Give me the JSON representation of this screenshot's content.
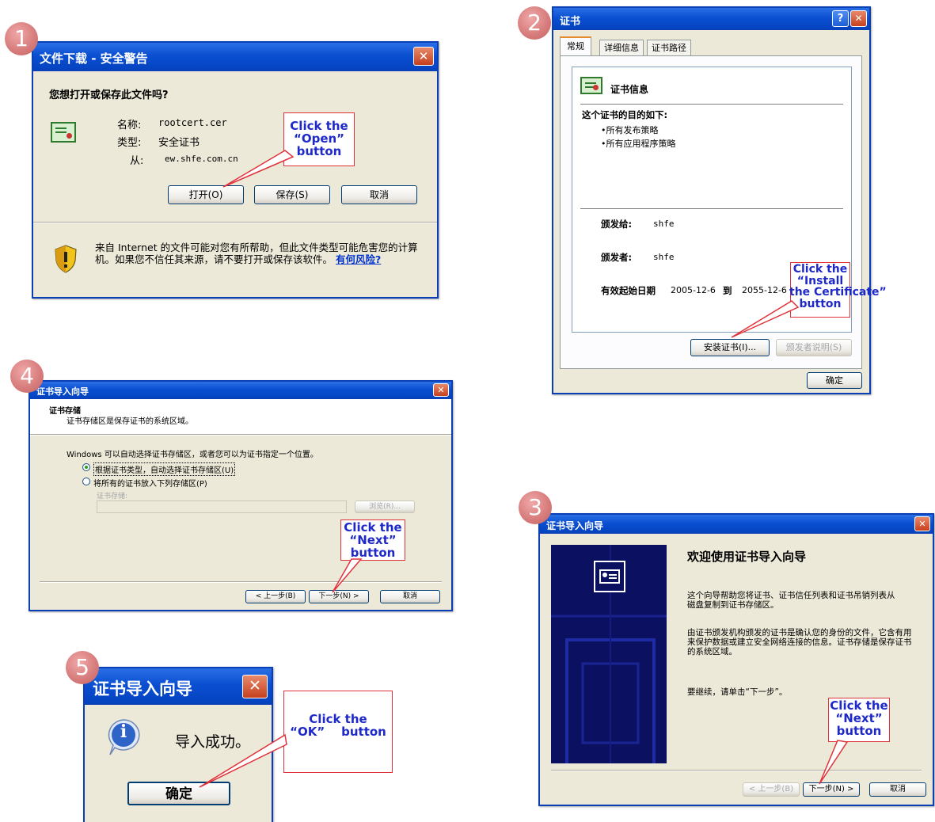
{
  "step1": {
    "badge": "1",
    "title": "文件下载 - 安全警告",
    "close": "✕",
    "question": "您想打开或保存此文件吗?",
    "name_label": "名称:",
    "name_value": "rootcert.cer",
    "type_label": "类型:",
    "type_value": "安全证书",
    "from_label": "从:",
    "from_value": "ew.shfe.com.cn",
    "open_btn": "打开(O)",
    "save_btn": "保存(S)",
    "cancel_btn": "取消",
    "warning_text": "来自 Internet 的文件可能对您有所帮助，但此文件类型可能危害您的计算机。如果您不信任其来源，请不要打开或保存该软件。",
    "risk_link": "有何风险?",
    "callout": [
      "Click the",
      "“Open”",
      "button"
    ]
  },
  "step2": {
    "badge": "2",
    "title": "证书",
    "help": "?",
    "close": "✕",
    "tabs": [
      "常规",
      "详细信息",
      "证书路径"
    ],
    "heading": "证书信息",
    "purpose": "这个证书的目的如下:",
    "bullets": [
      "•所有发布策略",
      "•所有应用程序策略"
    ],
    "issued_to_label": "颁发给:",
    "issued_to_value": "shfe",
    "issued_by_label": "颁发者:",
    "issued_by_value": "shfe",
    "valid_label": "有效起始日期",
    "valid_from": "2005-12-6",
    "valid_to_label": "到",
    "valid_to": "2055-12-6",
    "install_btn": "安装证书(I)...",
    "issuer_btn": "颁发者说明(S)",
    "ok_btn": "确定",
    "callout": [
      "Click the",
      "“Install",
      "the Certificate”",
      "button"
    ]
  },
  "step3": {
    "badge": "3",
    "title": "证书导入向导",
    "close": "✕",
    "heading": "欢迎使用证书导入向导",
    "para1": "这个向导帮助您将证书、证书信任列表和证书吊销列表从磁盘复制到证书存储区。",
    "para2": "由证书颁发机构颁发的证书是确认您的身份的文件，它含有用来保护数据或建立安全网络连接的信息。证书存储是保存证书的系统区域。",
    "para3": "要继续，请单击“下一步”。",
    "back_btn": "< 上一步(B)",
    "next_btn": "下一步(N) >",
    "cancel_btn": "取消",
    "callout": [
      "Click the",
      "“Next”",
      "button"
    ]
  },
  "step4": {
    "badge": "4",
    "title": "证书导入向导",
    "close": "✕",
    "heading": "证书存储",
    "subheading": "证书存储区是保存证书的系统区域。",
    "description": "Windows 可以自动选择证书存储区，或者您可以为证书指定一个位置。",
    "radio1": "根据证书类型，自动选择证书存储区(U)",
    "radio2": "将所有的证书放入下列存储区(P)",
    "store_label": "证书存储:",
    "browse_btn": "浏览(R)...",
    "back_btn": "< 上一步(B)",
    "next_btn": "下一步(N) >",
    "cancel_btn": "取消",
    "callout": [
      "Click the",
      "“Next”",
      "button"
    ]
  },
  "step5": {
    "badge": "5",
    "title": "证书导入向导",
    "close": "✕",
    "info_glyph": "i",
    "message": "导入成功。",
    "ok_btn": "确定",
    "callout": [
      "Click the",
      "“OK”    button"
    ]
  },
  "colors": {
    "title_blue": "#0a4fd1",
    "dialog_bg": "#ece9d8",
    "callout_border": "#e0323a",
    "callout_text": "#1f29c8",
    "badge": "#d67a7a"
  }
}
